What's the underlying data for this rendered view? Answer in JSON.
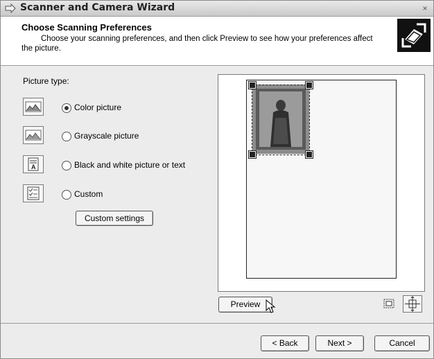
{
  "window": {
    "title": "Scanner and Camera Wizard",
    "close_glyph": "×"
  },
  "header": {
    "title": "Choose Scanning Preferences",
    "subtitle_line1": "Choose your scanning preferences, and then click Preview to see how your preferences affect",
    "subtitle_line2": "the picture.",
    "icon": "scanner-wizard-icon"
  },
  "picture_type": {
    "label": "Picture type:",
    "options": [
      {
        "label": "Color picture",
        "icon": "color-picture-icon",
        "checked": true
      },
      {
        "label": "Grayscale picture",
        "icon": "grayscale-picture-icon",
        "checked": false
      },
      {
        "label": "Black and white picture or text",
        "icon": "bw-text-icon",
        "checked": false
      },
      {
        "label": "Custom",
        "icon": "custom-icon",
        "checked": false
      }
    ],
    "custom_settings_label": "Custom settings"
  },
  "preview": {
    "preview_button": "Preview",
    "zoom_icon": "zoom-selection-icon",
    "fit_icon": "fit-page-icon"
  },
  "footer": {
    "back": "< Back",
    "next": "Next >",
    "cancel": "Cancel"
  }
}
